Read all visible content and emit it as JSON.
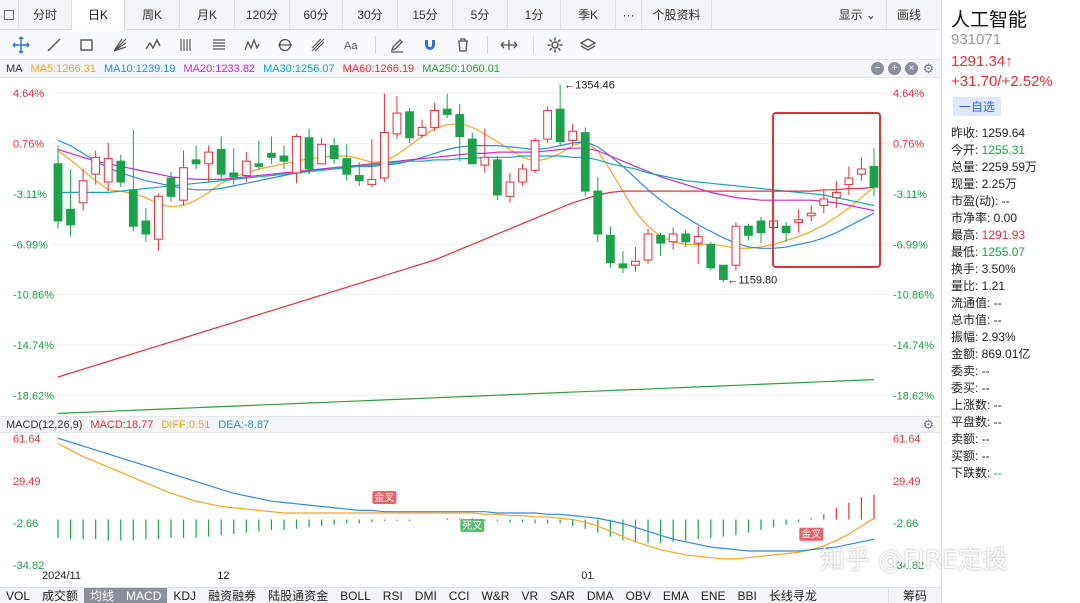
{
  "periods": [
    {
      "label": "分时",
      "w": 0
    },
    {
      "label": "日K",
      "active": true
    },
    {
      "label": "周K"
    },
    {
      "label": "月K"
    },
    {
      "label": "120分"
    },
    {
      "label": "60分"
    },
    {
      "label": "30分"
    },
    {
      "label": "15分"
    },
    {
      "label": "5分"
    },
    {
      "label": "1分"
    },
    {
      "label": "季K"
    },
    {
      "label": "···"
    },
    {
      "label": "个股资料"
    }
  ],
  "topbar_right": {
    "display": "显示 ⌄",
    "draw": "画线"
  },
  "ma_legend": {
    "name": "MA",
    "items": [
      {
        "text": "MA5:1266.31",
        "color": "#f5a623"
      },
      {
        "text": "MA10:1239.19",
        "color": "#2f8be0"
      },
      {
        "text": "MA20:1233.82",
        "color": "#c430c4"
      },
      {
        "text": "MA30:1256.07",
        "color": "#18a6b8"
      },
      {
        "text": "MA60:1266.19",
        "color": "#e0313c"
      },
      {
        "text": "MA250:1060.01",
        "color": "#2ea043"
      }
    ]
  },
  "macd_legend": {
    "name": "MACD(12,26,9)",
    "items": [
      {
        "text": "MACD:18.77",
        "color": "#e0313c"
      },
      {
        "text": "DIFF:0.51",
        "color": "#f5a623"
      },
      {
        "text": "DEA:-8.87",
        "color": "#2f8be0"
      }
    ]
  },
  "indicators": [
    "VOL",
    "成交额",
    "均线",
    "MACD",
    "KDJ",
    "融资融券",
    "陆股通资金",
    "BOLL",
    "RSI",
    "DMI",
    "CCI",
    "W&R",
    "VR",
    "SAR",
    "DMA",
    "OBV",
    "EMA",
    "ENE",
    "BBI",
    "长线寻龙"
  ],
  "indicators_active": [
    "均线",
    "MACD"
  ],
  "indicator_right": "筹码",
  "stock": {
    "name": "人工智能",
    "code": "931071",
    "price": "1291.34↑",
    "change": "+31.70/+2.52%",
    "watch": "一自选"
  },
  "stats": [
    {
      "k": "昨收:",
      "v": "1259.64",
      "c": ""
    },
    {
      "k": "今开:",
      "v": "1255.31",
      "c": "green"
    },
    {
      "k": "总量:",
      "v": "2259.59万",
      "c": ""
    },
    {
      "k": "现量:",
      "v": "2.25万",
      "c": ""
    },
    {
      "k": "市盈(动):",
      "v": "--",
      "c": ""
    },
    {
      "k": "市净率:",
      "v": "0.00",
      "c": ""
    },
    {
      "k": "最高:",
      "v": "1291.93",
      "c": "red"
    },
    {
      "k": "最低:",
      "v": "1255.07",
      "c": "green"
    },
    {
      "k": "换手:",
      "v": "3.50%",
      "c": ""
    },
    {
      "k": "量比:",
      "v": "1.21",
      "c": ""
    },
    {
      "k": "流通值:",
      "v": "--",
      "c": ""
    },
    {
      "k": "总市值:",
      "v": "--",
      "c": ""
    },
    {
      "k": "振幅:",
      "v": "2.93%",
      "c": ""
    },
    {
      "k": "金额:",
      "v": "869.01亿",
      "c": ""
    },
    {
      "k": "委卖:",
      "v": "--",
      "c": ""
    },
    {
      "k": "委买:",
      "v": "--",
      "c": ""
    },
    {
      "k": "上涨数:",
      "v": "--",
      "c": ""
    },
    {
      "k": "平盘数:",
      "v": "--",
      "c": ""
    },
    {
      "k": "卖额:",
      "v": "--",
      "c": ""
    },
    {
      "k": "买额:",
      "v": "--",
      "c": ""
    },
    {
      "k": "下跌数:",
      "v": "--",
      "c": "green"
    }
  ],
  "chart_data": {
    "type": "candlestick",
    "price_axis": {
      "ticks_pct": [
        "4.64%",
        "0.76%",
        "-3.11%",
        "-6.99%",
        "-10.86%",
        "-14.74%",
        "-18.62%"
      ],
      "range_pct": [
        -20.2,
        5.8
      ]
    },
    "x_labels": [
      {
        "text": "2024/11",
        "index": 0
      },
      {
        "text": "12",
        "index": 13
      },
      {
        "text": "01",
        "index": 42
      }
    ],
    "annotations": [
      {
        "text": "←1354.46",
        "index": 40,
        "pct": 5.3
      },
      {
        "text": "←1159.80",
        "index": 53,
        "pct": -9.7
      }
    ],
    "candles": [
      [
        -0.8,
        -5.2,
        0.6,
        -5.8
      ],
      [
        -4.3,
        -5.5,
        -1.2,
        -6.4
      ],
      [
        -3.8,
        -2.1,
        -1.2,
        -4.4
      ],
      [
        -1.6,
        -0.3,
        0.2,
        -2.4
      ],
      [
        -2.2,
        -0.4,
        0.8,
        -2.9
      ],
      [
        -0.6,
        -2.2,
        -0.1,
        -2.6
      ],
      [
        -2.8,
        -5.6,
        1.8,
        -6.0
      ],
      [
        -5.2,
        -6.2,
        -4.2,
        -6.8
      ],
      [
        -6.6,
        -3.3,
        -3.1,
        -7.5
      ],
      [
        -1.9,
        -3.3,
        -1.4,
        -3.7
      ],
      [
        -3.6,
        -1.1,
        0.2,
        -4.0
      ],
      [
        -0.5,
        -0.8,
        0.6,
        -1.2
      ],
      [
        -0.8,
        0.1,
        0.6,
        -2.2
      ],
      [
        0.3,
        -1.6,
        1.3,
        -2.0
      ],
      [
        -1.5,
        -1.8,
        0.4,
        -2.4
      ],
      [
        -1.7,
        -0.6,
        0.1,
        -2.2
      ],
      [
        -0.8,
        -1.0,
        1.0,
        -1.3
      ],
      [
        0.0,
        -0.3,
        1.3,
        -0.8
      ],
      [
        -0.2,
        -0.6,
        0.6,
        -1.2
      ],
      [
        -1.5,
        1.3,
        1.5,
        -2.3
      ],
      [
        1.2,
        -1.2,
        1.9,
        -1.6
      ],
      [
        -0.8,
        0.7,
        1.2,
        -0.8
      ],
      [
        0.6,
        -0.4,
        1.2,
        -0.8
      ],
      [
        -0.4,
        -1.6,
        0.7,
        -2.1
      ],
      [
        -1.7,
        -2.1,
        -0.7,
        -2.5
      ],
      [
        -2.4,
        -2.0,
        1.1,
        -2.6
      ],
      [
        -1.9,
        1.6,
        4.6,
        -2.2
      ],
      [
        1.5,
        3.1,
        4.4,
        1.1
      ],
      [
        3.2,
        1.2,
        3.5,
        0.8
      ],
      [
        1.4,
        2.0,
        2.6,
        1.2
      ],
      [
        2.0,
        3.3,
        3.9,
        1.7
      ],
      [
        3.4,
        3.0,
        4.6,
        2.7
      ],
      [
        3.0,
        1.3,
        3.8,
        -0.6
      ],
      [
        1.1,
        -0.8,
        1.6,
        -0.6
      ],
      [
        -0.9,
        -0.3,
        1.9,
        -1.5
      ],
      [
        -0.5,
        -3.2,
        -0.2,
        -3.6
      ],
      [
        -3.3,
        -2.2,
        -1.5,
        -3.8
      ],
      [
        -2.2,
        -1.2,
        -0.8,
        -2.5
      ],
      [
        -1.3,
        1.0,
        1.2,
        -1.5
      ],
      [
        1.1,
        3.3,
        3.6,
        0.8
      ],
      [
        3.4,
        0.9,
        5.3,
        0.6
      ],
      [
        1.0,
        1.7,
        2.3,
        0.6
      ],
      [
        1.6,
        -2.9,
        2.0,
        -3.3
      ],
      [
        -2.9,
        -6.2,
        -1.8,
        -6.8
      ],
      [
        -6.3,
        -8.4,
        -5.6,
        -8.8
      ],
      [
        -8.5,
        -8.8,
        -7.5,
        -9.2
      ],
      [
        -8.6,
        -8.3,
        -7.2,
        -9.1
      ],
      [
        -8.2,
        -6.2,
        -5.8,
        -8.5
      ],
      [
        -6.3,
        -6.9,
        -6.1,
        -7.9
      ],
      [
        -6.8,
        -6.2,
        -5.7,
        -7.4
      ],
      [
        -6.2,
        -6.8,
        -5.9,
        -7.2
      ],
      [
        -6.9,
        -6.4,
        -5.6,
        -8.5
      ],
      [
        -7.0,
        -8.8,
        -6.8,
        -9.0
      ],
      [
        -8.6,
        -9.7,
        -9.4,
        -9.9
      ],
      [
        -8.6,
        -5.6,
        -5.3,
        -9.0
      ],
      [
        -5.6,
        -6.3,
        -5.4,
        -6.7
      ],
      [
        -5.2,
        -6.1,
        -4.9,
        -6.9
      ],
      [
        -5.7,
        -5.2,
        -4.4,
        -6.1
      ],
      [
        -5.6,
        -6.1,
        -5.3,
        -6.8
      ],
      [
        -5.3,
        -5.1,
        -4.3,
        -6.1
      ],
      [
        -4.8,
        -4.6,
        -4.0,
        -5.2
      ],
      [
        -4.0,
        -3.5,
        -2.8,
        -4.6
      ],
      [
        -3.4,
        -3.0,
        -2.1,
        -4.2
      ],
      [
        -2.4,
        -1.9,
        -1.0,
        -3.2
      ],
      [
        -1.6,
        -1.2,
        -0.3,
        -2.1
      ],
      [
        -1.0,
        -2.6,
        0.4,
        -3.3
      ]
    ],
    "ma_series": {
      "MA5": [
        0.2,
        -0.5,
        -1.3,
        -2.1,
        -2.8,
        -2.9,
        -3.1,
        -3.4,
        -3.9,
        -4.1,
        -4.0,
        -3.6,
        -3.0,
        -2.3,
        -1.8,
        -1.5,
        -1.2,
        -1.0,
        -0.8,
        -0.6,
        -0.4,
        -0.3,
        -0.2,
        -0.2,
        -0.4,
        -0.7,
        -0.6,
        -0.1,
        0.6,
        1.3,
        1.9,
        2.2,
        2.3,
        2.0,
        1.5,
        0.9,
        0.3,
        -0.3,
        -0.6,
        -0.4,
        0.0,
        0.6,
        0.9,
        0.2,
        -1.3,
        -2.9,
        -4.5,
        -5.6,
        -6.4,
        -6.8,
        -7.0,
        -7.0,
        -7.0,
        -7.1,
        -7.3,
        -7.3,
        -7.2,
        -7.0,
        -6.7,
        -6.4,
        -6.0,
        -5.5,
        -4.9,
        -4.2,
        -3.4,
        -2.6
      ],
      "MA10": [
        1.0,
        0.6,
        0.0,
        -0.6,
        -1.1,
        -1.5,
        -1.8,
        -2.1,
        -2.3,
        -2.5,
        -2.7,
        -2.8,
        -2.8,
        -2.7,
        -2.5,
        -2.3,
        -2.1,
        -1.9,
        -1.7,
        -1.5,
        -1.3,
        -1.2,
        -1.1,
        -1.0,
        -1.0,
        -1.0,
        -0.9,
        -0.8,
        -0.6,
        -0.3,
        0.0,
        0.3,
        0.5,
        0.6,
        0.6,
        0.6,
        0.5,
        0.4,
        0.3,
        0.4,
        0.6,
        0.8,
        0.9,
        0.5,
        -0.2,
        -1.0,
        -1.9,
        -2.8,
        -3.6,
        -4.3,
        -4.9,
        -5.5,
        -6.0,
        -6.5,
        -6.9,
        -7.2,
        -7.3,
        -7.3,
        -7.2,
        -7.0,
        -6.8,
        -6.5,
        -6.1,
        -5.6,
        -5.1,
        -4.6
      ],
      "MA20": [
        0.3,
        0.0,
        -0.3,
        -0.6,
        -0.8,
        -1.0,
        -1.2,
        -1.4,
        -1.6,
        -1.8,
        -1.9,
        -2.0,
        -2.0,
        -2.0,
        -1.9,
        -1.8,
        -1.7,
        -1.6,
        -1.5,
        -1.4,
        -1.3,
        -1.2,
        -1.1,
        -1.0,
        -0.9,
        -0.8,
        -0.7,
        -0.6,
        -0.5,
        -0.4,
        -0.3,
        -0.2,
        -0.1,
        0.0,
        0.0,
        0.1,
        0.1,
        0.1,
        0.1,
        0.2,
        0.3,
        0.4,
        0.4,
        0.2,
        -0.2,
        -0.6,
        -1.0,
        -1.4,
        -1.8,
        -2.1,
        -2.4,
        -2.7,
        -3.0,
        -3.2,
        -3.4,
        -3.5,
        -3.6,
        -3.6,
        -3.6,
        -3.6,
        -3.6,
        -3.7,
        -3.8,
        -4.0,
        -4.2,
        -4.4
      ],
      "MA30": [
        -3.0,
        -3.0,
        -3.0,
        -3.0,
        -3.0,
        -2.9,
        -2.8,
        -2.7,
        -2.6,
        -2.5,
        -2.4,
        -2.3,
        -2.2,
        -2.1,
        -2.0,
        -1.9,
        -1.8,
        -1.7,
        -1.6,
        -1.5,
        -1.4,
        -1.3,
        -1.2,
        -1.1,
        -1.0,
        -0.9,
        -0.8,
        -0.7,
        -0.6,
        -0.6,
        -0.5,
        -0.5,
        -0.4,
        -0.4,
        -0.3,
        -0.3,
        -0.3,
        -0.2,
        -0.2,
        -0.2,
        -0.2,
        -0.3,
        -0.3,
        -0.5,
        -0.8,
        -1.0,
        -1.2,
        -1.5,
        -1.7,
        -1.9,
        -2.1,
        -2.2,
        -2.3,
        -2.4,
        -2.5,
        -2.6,
        -2.7,
        -2.8,
        -2.9,
        -3.0,
        -3.1,
        -3.2,
        -3.4,
        -3.6,
        -3.8,
        -4.0
      ],
      "MA60": [
        -17.2,
        -16.9,
        -16.6,
        -16.3,
        -16.0,
        -15.7,
        -15.4,
        -15.1,
        -14.8,
        -14.5,
        -14.2,
        -13.9,
        -13.6,
        -13.3,
        -13.0,
        -12.7,
        -12.4,
        -12.1,
        -11.8,
        -11.5,
        -11.2,
        -10.9,
        -10.6,
        -10.3,
        -10.0,
        -9.7,
        -9.4,
        -9.1,
        -8.8,
        -8.5,
        -8.2,
        -7.8,
        -7.4,
        -7.0,
        -6.6,
        -6.2,
        -5.8,
        -5.4,
        -5.0,
        -4.6,
        -4.2,
        -3.8,
        -3.5,
        -3.2,
        -3.0,
        -2.9,
        -2.9,
        -2.9,
        -2.9,
        -2.9,
        -2.9,
        -2.9,
        -2.9,
        -2.9,
        -2.9,
        -2.9,
        -2.9,
        -2.9,
        -2.9,
        -2.9,
        -2.9,
        -2.8,
        -2.8,
        -2.7,
        -2.7,
        -2.6
      ],
      "MA250": [
        -20.0,
        -19.96,
        -19.92,
        -19.88,
        -19.84,
        -19.8,
        -19.76,
        -19.72,
        -19.68,
        -19.64,
        -19.6,
        -19.56,
        -19.52,
        -19.48,
        -19.44,
        -19.4,
        -19.36,
        -19.32,
        -19.28,
        -19.24,
        -19.2,
        -19.16,
        -19.12,
        -19.08,
        -19.04,
        -19.0,
        -18.96,
        -18.92,
        -18.88,
        -18.84,
        -18.8,
        -18.76,
        -18.72,
        -18.68,
        -18.64,
        -18.6,
        -18.56,
        -18.52,
        -18.48,
        -18.44,
        -18.4,
        -18.36,
        -18.32,
        -18.28,
        -18.24,
        -18.2,
        -18.16,
        -18.12,
        -18.08,
        -18.04,
        -18.0,
        -17.96,
        -17.92,
        -17.88,
        -17.84,
        -17.8,
        -17.76,
        -17.72,
        -17.68,
        -17.64,
        -17.6,
        -17.56,
        -17.52,
        -17.48,
        -17.44,
        -17.4
      ]
    },
    "macd_axis": {
      "ticks": [
        "61.64",
        "29.49",
        "-2.66",
        "-34.82"
      ],
      "range": [
        -40,
        66
      ]
    },
    "macd_series": {
      "DIFF": [
        58,
        53,
        48,
        44,
        40,
        36,
        32,
        28,
        24,
        20,
        17,
        14,
        12,
        10,
        9,
        8,
        7,
        6,
        5,
        5,
        5,
        5,
        5,
        5,
        5,
        5,
        5,
        5,
        5,
        5,
        5,
        5,
        5,
        5,
        4,
        4,
        3,
        3,
        2,
        2,
        1,
        0,
        -2,
        -5,
        -9,
        -13,
        -17,
        -20,
        -23,
        -25,
        -27,
        -28,
        -29,
        -30,
        -30,
        -29,
        -28,
        -27,
        -26,
        -25,
        -23,
        -20,
        -16,
        -11,
        -5,
        1
      ],
      "DEA": [
        62,
        59,
        56,
        53,
        50,
        47,
        44,
        41,
        38,
        35,
        32,
        29,
        26,
        23,
        20,
        18,
        16,
        14,
        13,
        12,
        11,
        10,
        9,
        8,
        7,
        7,
        6,
        6,
        6,
        6,
        6,
        6,
        6,
        6,
        6,
        5,
        5,
        5,
        5,
        4,
        4,
        3,
        2,
        1,
        -1,
        -3,
        -6,
        -9,
        -12,
        -15,
        -17,
        -19,
        -21,
        -22,
        -23,
        -24,
        -24,
        -24,
        -24,
        -24,
        -23,
        -22,
        -21,
        -19,
        -17,
        -15
      ],
      "MACD": [
        -14,
        -15,
        -15,
        -15,
        -16,
        -16,
        -16,
        -15,
        -15,
        -14,
        -14,
        -14,
        -13,
        -12,
        -11,
        -10,
        -9,
        -8,
        -8,
        -7,
        -6,
        -5,
        -4,
        -3,
        -3,
        -2,
        -1,
        -1,
        -1,
        0,
        0,
        1,
        1,
        1,
        -1,
        -1,
        -2,
        -2,
        -3,
        -3,
        -3,
        -5,
        -7,
        -10,
        -13,
        -16,
        -17,
        -18,
        -18,
        -17,
        -16,
        -15,
        -14,
        -13,
        -12,
        -10,
        -8,
        -6,
        -4,
        -2,
        1,
        4,
        9,
        13,
        17,
        19
      ]
    },
    "macd_signals": [
      {
        "text": "金叉",
        "index": 26
      },
      {
        "text": "死叉",
        "index": 33
      },
      {
        "text": "金叉",
        "index": 60
      }
    ]
  },
  "watermark": "知乎 @FIRE定投"
}
